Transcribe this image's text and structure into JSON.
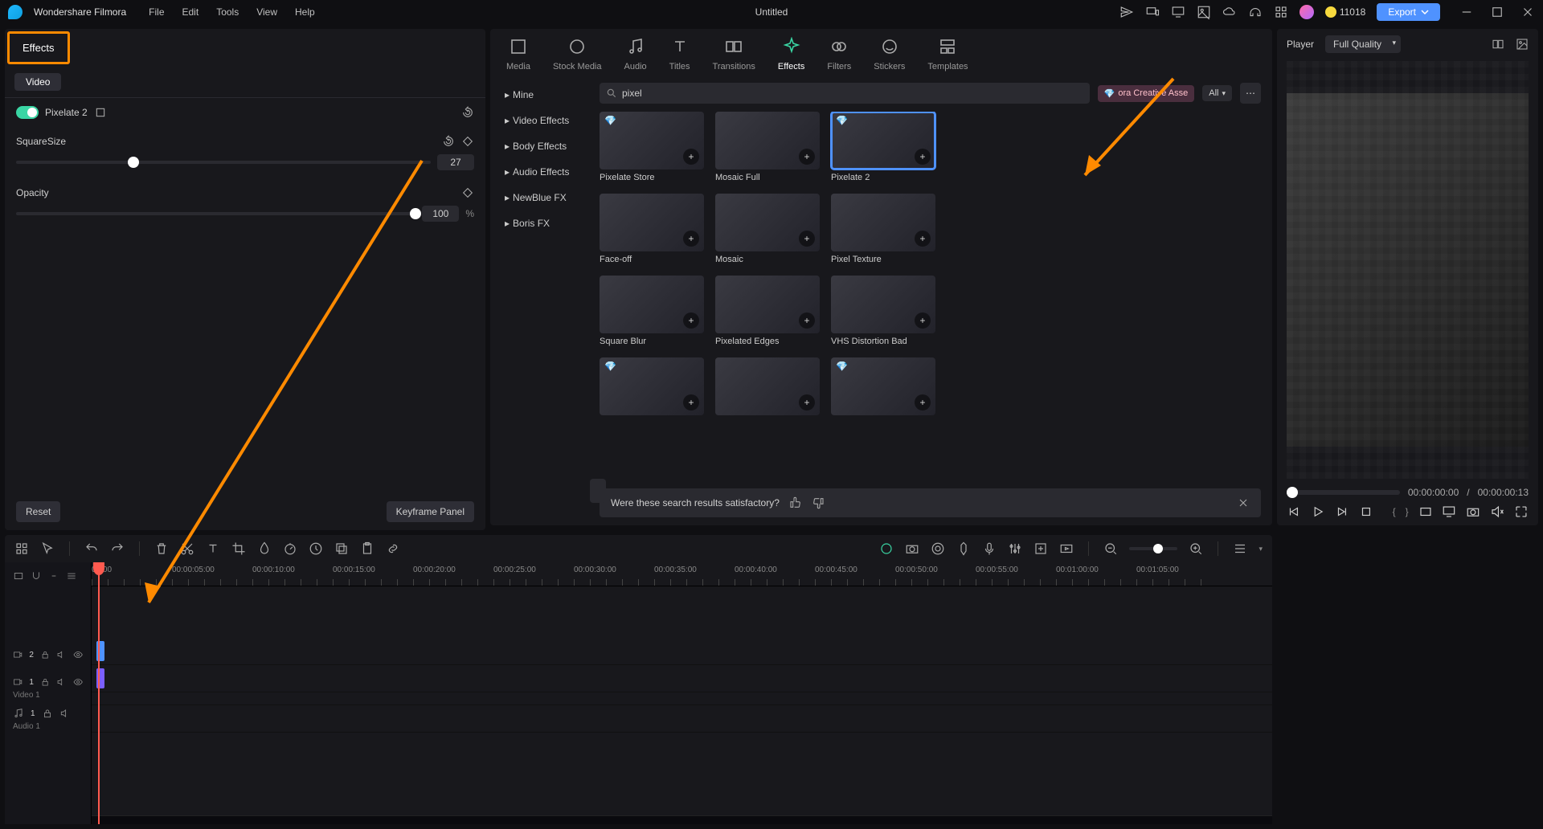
{
  "app": {
    "name": "Wondershare Filmora",
    "title": "Untitled"
  },
  "menu": [
    "File",
    "Edit",
    "Tools",
    "View",
    "Help"
  ],
  "points": "11018",
  "export": "Export",
  "tabs": [
    "Media",
    "Stock Media",
    "Audio",
    "Titles",
    "Transitions",
    "Effects",
    "Filters",
    "Stickers",
    "Templates"
  ],
  "activeTab": "Effects",
  "sidebar": [
    "Mine",
    "Video Effects",
    "Body Effects",
    "Audio Effects",
    "NewBlue FX",
    "Boris FX"
  ],
  "search": {
    "value": "pixel",
    "premium": "ora Creative Asse",
    "all": "All"
  },
  "gallery": [
    {
      "label": "Pixelate Store",
      "gem": true
    },
    {
      "label": "Mosaic Full",
      "gem": false
    },
    {
      "label": "Pixelate 2",
      "gem": true,
      "selected": true
    },
    {
      "label": "Face-off",
      "gem": false
    },
    {
      "label": "Mosaic",
      "gem": false
    },
    {
      "label": "Pixel Texture",
      "gem": false
    },
    {
      "label": "Square Blur",
      "gem": false
    },
    {
      "label": "Pixelated Edges",
      "gem": false
    },
    {
      "label": "VHS Distortion Bad",
      "gem": false
    },
    {
      "label": "",
      "gem": true
    },
    {
      "label": "",
      "gem": false
    },
    {
      "label": "",
      "gem": true
    }
  ],
  "feedback": "Were these search results satisfactory?",
  "preview": {
    "player": "Player",
    "quality": "Full Quality",
    "tc_cur": "00:00:00:00",
    "tc_sep": "/",
    "tc_dur": "00:00:00:13"
  },
  "effects": {
    "tab": "Effects",
    "subtab": "Video",
    "name": "Pixelate 2",
    "props": {
      "squareSize": {
        "label": "SquareSize",
        "value": "27",
        "pct": 27
      },
      "opacity": {
        "label": "Opacity",
        "value": "100",
        "unit": "%",
        "pct": 100
      }
    },
    "footer": {
      "reset": "Reset",
      "keyframe": "Keyframe Panel"
    }
  },
  "timeline": {
    "marks": [
      "00:00",
      "00:00:05:00",
      "00:00:10:00",
      "00:00:15:00",
      "00:00:20:00",
      "00:00:25:00",
      "00:00:30:00",
      "00:00:35:00",
      "00:00:40:00",
      "00:00:45:00",
      "00:00:50:00",
      "00:00:55:00",
      "00:01:00:00",
      "00:01:05:00"
    ],
    "tracks": {
      "v2": "2",
      "v1": "1",
      "v1lbl": "Video 1",
      "a1": "1",
      "a1lbl": "Audio 1"
    }
  }
}
